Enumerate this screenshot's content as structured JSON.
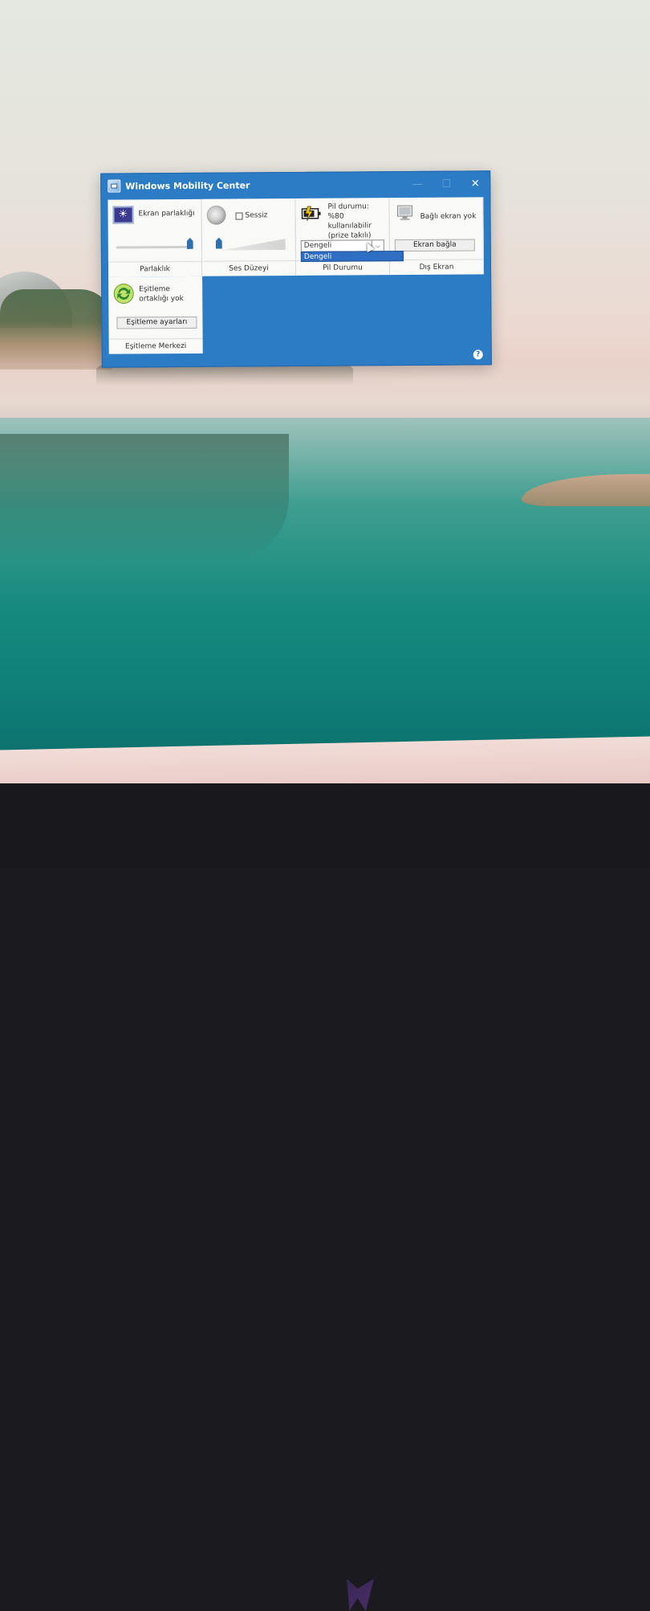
{
  "window": {
    "title": "Windows Mobility Center",
    "minimize_glyph": "—",
    "maximize_glyph": "☐",
    "close_glyph": "✕",
    "accent": "#2b7bc5",
    "help_glyph": "?"
  },
  "brightness": {
    "label": "Ekran parlaklığı",
    "footer": "Parlaklık",
    "level": 1.0
  },
  "volume": {
    "mute_label": "Sessiz",
    "footer": "Ses Düzeyi",
    "level": 0.08
  },
  "battery": {
    "status": "Pil durumu: %80 kullanılabilir (prize takılı)",
    "selected_plan": "Dengeli",
    "dropdown_option": "Dengeli",
    "footer": "Pil Durumu"
  },
  "external_display": {
    "status": "Bağlı ekran yok",
    "button": "Ekran bağla",
    "footer": "Dış Ekran"
  },
  "sync": {
    "status": "Eşitleme ortaklığı yok",
    "button": "Eşitleme ayarları",
    "footer": "Eşitleme Merkezi"
  },
  "icons": {
    "app": "mobility-center-icon",
    "brightness": "brightness-icon",
    "volume": "speaker-icon",
    "battery": "battery-plug-icon",
    "display": "monitor-icon",
    "sync": "sync-icon",
    "help": "help-icon"
  }
}
